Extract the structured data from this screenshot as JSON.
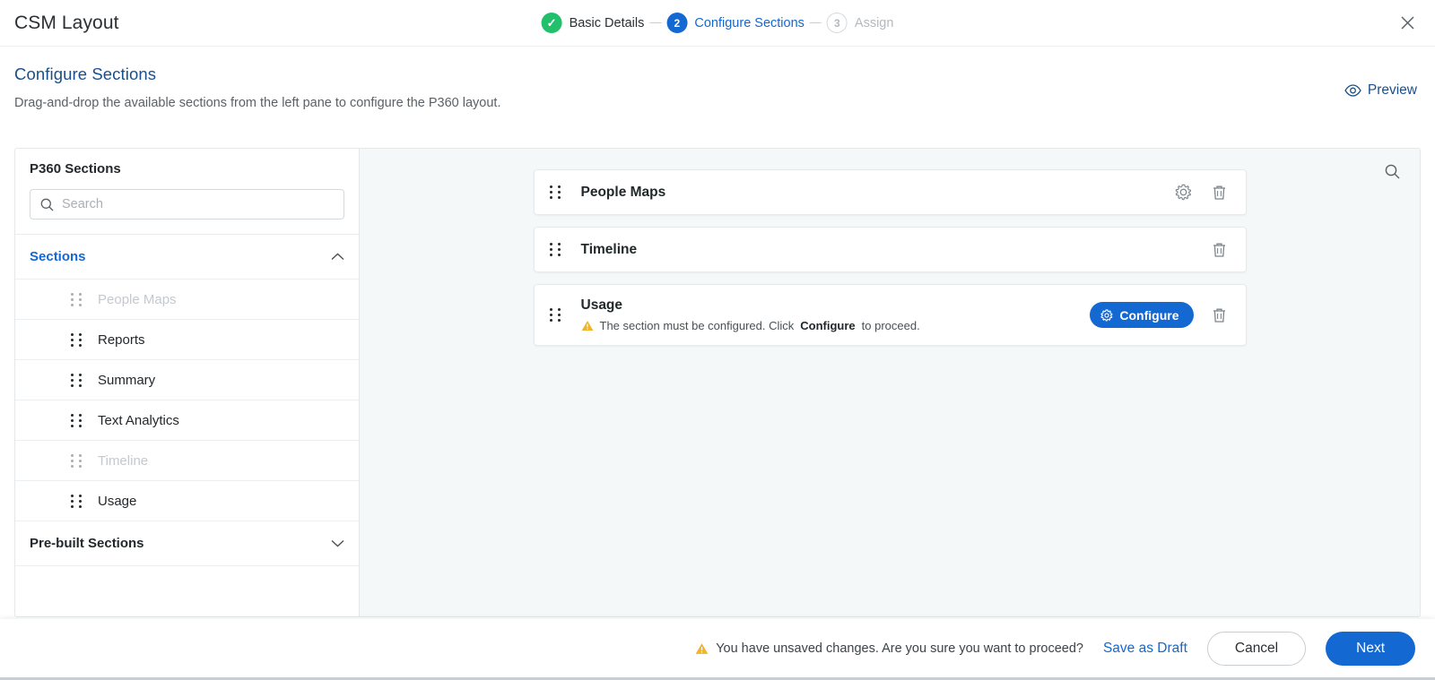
{
  "header": {
    "app_title": "CSM Layout",
    "close_icon": "close-icon",
    "steps": [
      {
        "badge": "✓",
        "label": "Basic Details",
        "state": "done"
      },
      {
        "badge": "2",
        "label": "Configure Sections",
        "state": "active"
      },
      {
        "badge": "3",
        "label": "Assign",
        "state": "todo"
      }
    ]
  },
  "page": {
    "title": "Configure Sections",
    "subtitle": "Drag-and-drop the available sections from the left pane to configure the P360 layout.",
    "preview_label": "Preview",
    "preview_icon": "eye-icon"
  },
  "sidebar": {
    "title": "P360 Sections",
    "search": {
      "placeholder": "Search",
      "value": "",
      "icon": "search-icon"
    },
    "groups": [
      {
        "label": "Sections",
        "expanded": true,
        "chevron_icon": "chevron-up-icon",
        "items": [
          {
            "label": "People Maps",
            "disabled": true,
            "icon": "drag-handle-icon"
          },
          {
            "label": "Reports",
            "disabled": false,
            "icon": "drag-handle-icon"
          },
          {
            "label": "Summary",
            "disabled": false,
            "icon": "drag-handle-icon"
          },
          {
            "label": "Text Analytics",
            "disabled": false,
            "icon": "drag-handle-icon"
          },
          {
            "label": "Timeline",
            "disabled": true,
            "icon": "drag-handle-icon"
          },
          {
            "label": "Usage",
            "disabled": false,
            "icon": "drag-handle-icon"
          }
        ]
      },
      {
        "label": "Pre-built Sections",
        "expanded": false,
        "chevron_icon": "chevron-down-icon",
        "items": []
      }
    ]
  },
  "canvas": {
    "search_icon": "search-icon",
    "cards": [
      {
        "title": "People Maps",
        "drag_icon": "drag-handle-icon",
        "has_settings": true,
        "settings_icon": "gear-icon",
        "delete_icon": "trash-icon",
        "warning": null,
        "configure_label": null
      },
      {
        "title": "Timeline",
        "drag_icon": "drag-handle-icon",
        "has_settings": false,
        "settings_icon": null,
        "delete_icon": "trash-icon",
        "warning": null,
        "configure_label": null
      },
      {
        "title": "Usage",
        "drag_icon": "drag-handle-icon",
        "has_settings": false,
        "settings_icon": null,
        "delete_icon": "trash-icon",
        "warning": {
          "icon": "warning-triangle-icon",
          "text_before": "The section must be configured. Click ",
          "text_bold": "Configure",
          "text_after": " to proceed."
        },
        "configure_label": "Configure",
        "configure_icon": "gear-icon"
      }
    ]
  },
  "footer": {
    "unsaved_icon": "warning-triangle-icon",
    "unsaved_text": "You have unsaved changes. Are you sure you want to proceed?",
    "save_draft_label": "Save as Draft",
    "cancel_label": "Cancel",
    "next_label": "Next"
  },
  "colors": {
    "accent_blue": "#1468d1",
    "success_green": "#21c16b",
    "warning_amber": "#f0b429",
    "title_blue": "#1a4f8a",
    "canvas_bg": "#f4f8f9"
  }
}
